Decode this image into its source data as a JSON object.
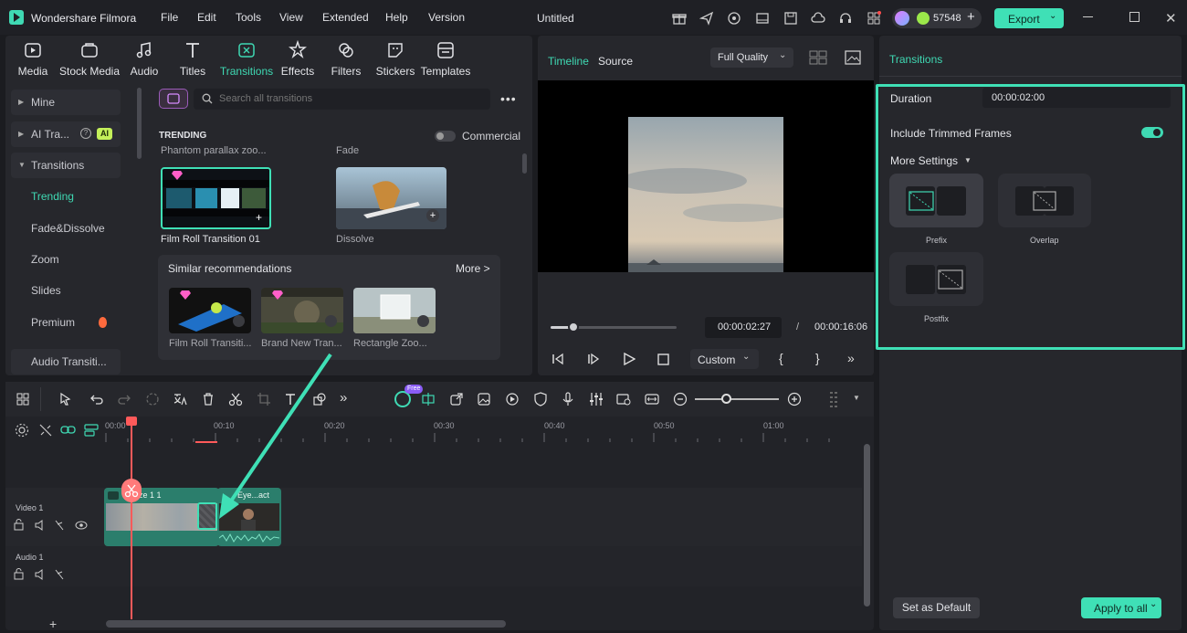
{
  "app": {
    "name": "Wondershare Filmora",
    "project_title": "Untitled",
    "credits": "57548",
    "export_label": "Export",
    "menu": [
      "File",
      "Edit",
      "Tools",
      "View",
      "Extended",
      "Help",
      "Version"
    ]
  },
  "tabs": [
    "Media",
    "Stock Media",
    "Audio",
    "Titles",
    "Transitions",
    "Effects",
    "Filters",
    "Stickers",
    "Templates"
  ],
  "active_tab": "Transitions",
  "sidebar": {
    "items": [
      {
        "label": "Mine"
      },
      {
        "label": "AI Tra...",
        "badge": "AI"
      },
      {
        "label": "Transitions"
      },
      {
        "label": "Trending"
      },
      {
        "label": "Fade&Dissolve"
      },
      {
        "label": "Zoom"
      },
      {
        "label": "Slides"
      },
      {
        "label": "Premium"
      },
      {
        "label": "Audio Transiti..."
      }
    ]
  },
  "search": {
    "placeholder": "Search all transitions"
  },
  "library": {
    "section_title": "TRENDING",
    "commercial_label": "Commercial",
    "top_labels": [
      "Phantom parallax zoo...",
      "Fade"
    ],
    "items": [
      {
        "label": "Film Roll Transition 01"
      },
      {
        "label": "Dissolve"
      }
    ],
    "similar": {
      "title": "Similar recommendations",
      "more": "More >",
      "items": [
        {
          "label": "Film Roll Transiti..."
        },
        {
          "label": "Brand New Tran..."
        },
        {
          "label": "Rectangle Zoo..."
        }
      ]
    }
  },
  "player": {
    "tabs": [
      "Timeline",
      "Source"
    ],
    "quality": "Full Quality",
    "current_time": "00:00:02:27",
    "separator": "/",
    "total_time": "00:00:16:06",
    "speed": "Custom",
    "progress": 0.18
  },
  "timeline": {
    "ruler": [
      "00:00",
      "00:10",
      "00:20",
      "00:30",
      "00:40",
      "00:50",
      "01:00"
    ],
    "free_badge": "Free",
    "tracks": [
      {
        "name": "Video 1"
      },
      {
        "name": "Audio 1"
      }
    ],
    "clips": [
      {
        "label": "ze 1 1"
      },
      {
        "label": "Eye...act"
      }
    ]
  },
  "properties": {
    "title": "Transitions",
    "duration_label": "Duration",
    "duration_value": "00:00:02:00",
    "include_trimmed_label": "Include Trimmed Frames",
    "include_trimmed_on": true,
    "more_settings": "More Settings",
    "modes": [
      "Prefix",
      "Overlap",
      "Postfix"
    ],
    "selected_mode": "Prefix",
    "set_default": "Set as Default",
    "apply_all": "Apply to all"
  },
  "colors": {
    "accent": "#3fd9b3",
    "highlight_border": "#3fe0b6",
    "playhead": "#ff5a5a",
    "clip": "#2b7e6c"
  }
}
